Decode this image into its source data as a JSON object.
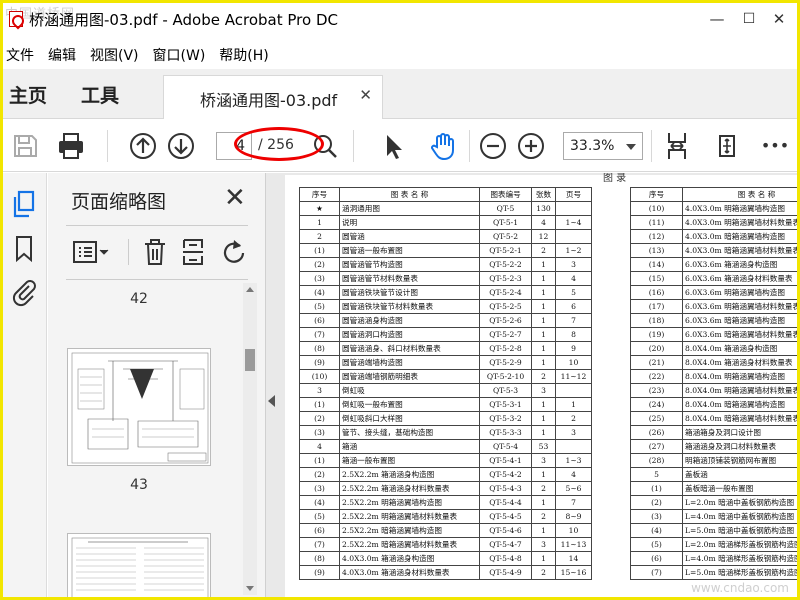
{
  "window": {
    "title": "桥涵通用图-03.pdf - Adobe Acrobat Pro DC",
    "watermark_top": "中国道桥网",
    "minimize": "—",
    "maximize": "☐",
    "close": "✕"
  },
  "menu": [
    "文件",
    "编辑",
    "视图(V)",
    "窗口(W)",
    "帮助(H)"
  ],
  "tabs": {
    "home": "主页",
    "tools": "工具",
    "document": "桥涵通用图-03.pdf",
    "close": "✕"
  },
  "toolbar": {
    "current_page": "4",
    "total_pages": "/ 256",
    "zoom": "33.3%",
    "more": "•••"
  },
  "panel": {
    "title": "页面缩略图",
    "close": "✕",
    "thumbnails": [
      {
        "label": "42"
      },
      {
        "label": "43"
      }
    ]
  },
  "document": {
    "header_fragment": "图 录",
    "watermark_bottom": "www.cndao.com",
    "left_table": {
      "headers": [
        "序号",
        "图 表 名 称",
        "图表编号",
        "张数",
        "页号"
      ],
      "rows": [
        [
          "★",
          "涵洞通用图",
          "QT-5",
          "130",
          ""
        ],
        [
          "1",
          "说明",
          "QT-5-1",
          "4",
          "1~4"
        ],
        [
          "2",
          "圆管涵",
          "QT-5-2",
          "12",
          ""
        ],
        [
          "(1)",
          "圆管涵一般布置图",
          "QT-5-2-1",
          "2",
          "1~2"
        ],
        [
          "(2)",
          "圆管涵管节构造图",
          "QT-5-2-2",
          "1",
          "3"
        ],
        [
          "(3)",
          "圆管涵管节材料数量表",
          "QT-5-2-3",
          "1",
          "4"
        ],
        [
          "(4)",
          "圆管涵铁块管节设计图",
          "QT-5-2-4",
          "1",
          "5"
        ],
        [
          "(5)",
          "圆管涵铁块管节材料数量表",
          "QT-5-2-5",
          "1",
          "6"
        ],
        [
          "(6)",
          "圆管涵涵身构造图",
          "QT-5-2-6",
          "1",
          "7"
        ],
        [
          "(7)",
          "圆管涵洞口构造图",
          "QT-5-2-7",
          "1",
          "8"
        ],
        [
          "(8)",
          "圆管涵涵身、斜口材料数量表",
          "QT-5-2-8",
          "1",
          "9"
        ],
        [
          "(9)",
          "圆管涵端墙构造图",
          "QT-5-2-9",
          "1",
          "10"
        ],
        [
          "(10)",
          "圆管涵端墙钢筋明细表",
          "QT-5-2-10",
          "2",
          "11~12"
        ],
        [
          "3",
          "倒虹吸",
          "QT-5-3",
          "3",
          ""
        ],
        [
          "(1)",
          "倒虹吸一般布置图",
          "QT-5-3-1",
          "1",
          "1"
        ],
        [
          "(2)",
          "倒虹吸斜口大样图",
          "QT-5-3-2",
          "1",
          "2"
        ],
        [
          "(3)",
          "管节、接头缝，基础构造图",
          "QT-5-3-3",
          "1",
          "3"
        ],
        [
          "4",
          "箱涵",
          "QT-5-4",
          "53",
          ""
        ],
        [
          "(1)",
          "箱涵一般布置图",
          "QT-5-4-1",
          "3",
          "1~3"
        ],
        [
          "(2)",
          "2.5X2.2m 箱涵涵身构造图",
          "QT-5-4-2",
          "1",
          "4"
        ],
        [
          "(3)",
          "2.5X2.2m 箱涵涵身材料数量表",
          "QT-5-4-3",
          "2",
          "5~6"
        ],
        [
          "(4)",
          "2.5X2.2m 明箱涵翼墙构造图",
          "QT-5-4-4",
          "1",
          "7"
        ],
        [
          "(5)",
          "2.5X2.2m 明箱涵翼墙材料数量表",
          "QT-5-4-5",
          "2",
          "8~9"
        ],
        [
          "(6)",
          "2.5X2.2m 暗箱涵翼墙构造图",
          "QT-5-4-6",
          "1",
          "10"
        ],
        [
          "(7)",
          "2.5X2.2m 暗箱涵翼墙材料数量表",
          "QT-5-4-7",
          "3",
          "11~13"
        ],
        [
          "(8)",
          "4.0X3.0m 箱涵涵身构造图",
          "QT-5-4-8",
          "1",
          "14"
        ],
        [
          "(9)",
          "4.0X3.0m 箱涵涵身材料数量表",
          "QT-5-4-9",
          "2",
          "15~16"
        ]
      ]
    },
    "right_table": {
      "headers": [
        "序号",
        "图 表 名 称"
      ],
      "rows": [
        [
          "(10)",
          "4.0X3.0m 明箱涵翼墙构造图"
        ],
        [
          "(11)",
          "4.0X3.0m 明箱涵翼墙材料数量表"
        ],
        [
          "(12)",
          "4.0X3.0m 暗箱涵翼墙构造图"
        ],
        [
          "(13)",
          "4.0X3.0m 暗箱涵翼墙材料数量表"
        ],
        [
          "(14)",
          "6.0X3.6m 箱涵涵身构造图"
        ],
        [
          "(15)",
          "6.0X3.6m 箱涵涵身材料数量表"
        ],
        [
          "(16)",
          "6.0X3.6m 明箱涵翼墙构造图"
        ],
        [
          "(17)",
          "6.0X3.6m 明箱涵翼墙材料数量表"
        ],
        [
          "(18)",
          "6.0X3.6m 暗箱涵翼墙构造图"
        ],
        [
          "(19)",
          "6.0X3.6m 暗箱涵翼墙材料数量表"
        ],
        [
          "(20)",
          "8.0X4.0m 箱涵涵身构造图"
        ],
        [
          "(21)",
          "8.0X4.0m 箱涵涵身材料数量表"
        ],
        [
          "(22)",
          "8.0X4.0m 明箱涵翼墙构造图"
        ],
        [
          "(23)",
          "8.0X4.0m 明箱涵翼墙材料数量表"
        ],
        [
          "(24)",
          "8.0X4.0m 暗箱涵翼墙构造图"
        ],
        [
          "(25)",
          "8.0X4.0m 暗箱涵翼墙材料数量表"
        ],
        [
          "(26)",
          "箱涵箱身及洞口设计图"
        ],
        [
          "(27)",
          "箱涵涵身及洞口材料数量表"
        ],
        [
          "(28)",
          "明箱涵顶铺装钢筋网布置图"
        ],
        [
          "5",
          "盖板涵"
        ],
        [
          "(1)",
          "盖板暗涵一般布置图"
        ],
        [
          "(2)",
          "L=2.0m 暗涵中盖板钢筋构造图"
        ],
        [
          "(3)",
          "L=4.0m 暗涵中盖板钢筋构造图"
        ],
        [
          "(4)",
          "L=5.0m 暗涵中盖板钢筋构造图"
        ],
        [
          "(5)",
          "L=2.0m 暗涵梯形盖板钢筋构造图"
        ],
        [
          "(6)",
          "L=4.0m 暗涵梯形盖板钢筋构造图"
        ],
        [
          "(7)",
          "L=5.0m 暗涵梯形盖板钢筋构造图"
        ]
      ]
    }
  },
  "colors": {
    "frame": "#f2e600",
    "annotation": "#e00000",
    "accent": "#1473e6"
  }
}
